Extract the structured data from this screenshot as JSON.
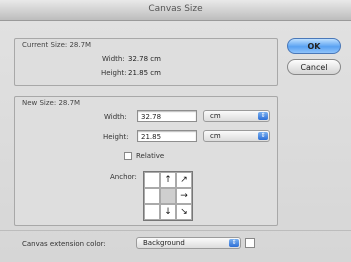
{
  "window": {
    "title": "Canvas Size"
  },
  "current_size": {
    "group_label": "Current Size: 28.7M",
    "width_label": "Width:",
    "width_value": "32.78 cm",
    "height_label": "Height:",
    "height_value": "21.85 cm"
  },
  "new_size": {
    "group_label": "New Size: 28.7M",
    "width_label": "Width:",
    "width_value": "32.78",
    "width_unit": "cm",
    "height_label": "Height:",
    "height_value": "21.85",
    "height_unit": "cm",
    "relative_label": "Relative",
    "relative_checked": false,
    "anchor_label": "Anchor:",
    "anchor_cells": [
      "",
      "↑",
      "↗",
      "",
      "",
      "→",
      "",
      "↓",
      "↘"
    ]
  },
  "buttons": {
    "ok": "OK",
    "cancel": "Cancel"
  },
  "extension": {
    "label": "Canvas extension color:",
    "value": "Background",
    "swatch_color": "#ffffff"
  },
  "colors": {
    "accent": "#5aa2f2"
  }
}
